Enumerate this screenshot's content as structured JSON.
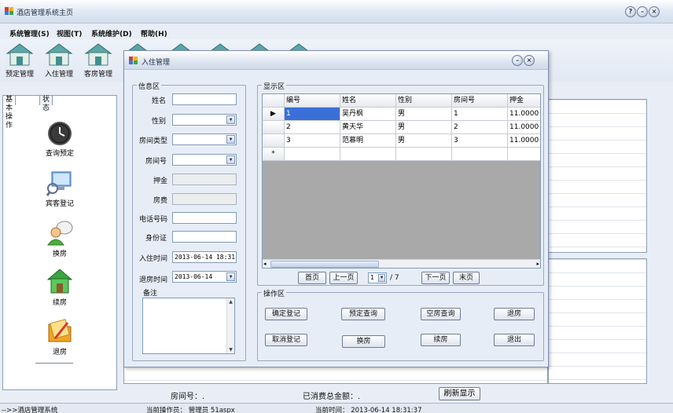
{
  "window": {
    "title": "酒店管理系统主页",
    "controls": [
      "?",
      "–",
      "×"
    ]
  },
  "menu": [
    "系统管理(S)",
    "视图(T)",
    "系统维护(D)",
    "帮助(H)"
  ],
  "toolbar": [
    "预定管理",
    "入住管理",
    "客房管理"
  ],
  "left_tabs": [
    "基本操作",
    "状态"
  ],
  "sidebar": [
    "查询预定",
    "宾客登记",
    "换房",
    "续房",
    "退房"
  ],
  "dialog": {
    "title": "入住管理",
    "info_group": "信息区",
    "display_group": "显示区",
    "ops_group": "操作区",
    "fields": {
      "name": "姓名",
      "gender": "性别",
      "room_type": "房间类型",
      "room_no": "房间号",
      "deposit": "押金",
      "room_fee": "房费",
      "phone": "电话号码",
      "id_card": "身份证",
      "checkin_time": "入住时间",
      "checkin_value": "2013-06-14 18:31:37",
      "checkout_time": "退房时间",
      "checkout_value": "2013-06-14",
      "remark": "备注"
    },
    "grid": {
      "columns": [
        "编号",
        "姓名",
        "性别",
        "房间号",
        "押金"
      ],
      "rows": [
        [
          "1",
          "吴丹枫",
          "男",
          "1",
          "11.0000"
        ],
        [
          "2",
          "黄天华",
          "男",
          "2",
          "11.0000"
        ],
        [
          "3",
          "范慕明",
          "男",
          "3",
          "11.0000"
        ]
      ],
      "current_row_marker": "▶",
      "new_row_marker": "*"
    },
    "pager": {
      "first": "首页",
      "prev": "上一页",
      "page": "1",
      "total": "/ 7",
      "next": "下一页",
      "last": "末页"
    },
    "ops": [
      "确定登记",
      "预定查询",
      "空房查询",
      "退房",
      "取消登记",
      "换房",
      "续房",
      "退出"
    ]
  },
  "bottom": {
    "room_label": "房间号：.",
    "total_label": "已消费总金额：.",
    "refresh": "刷新显示"
  },
  "status": {
    "app": "-->>酒店管理系统",
    "operator": "当前操作员： 管理员 51aspx",
    "time": "当前时间： 2013-06-14 18:31:37"
  }
}
